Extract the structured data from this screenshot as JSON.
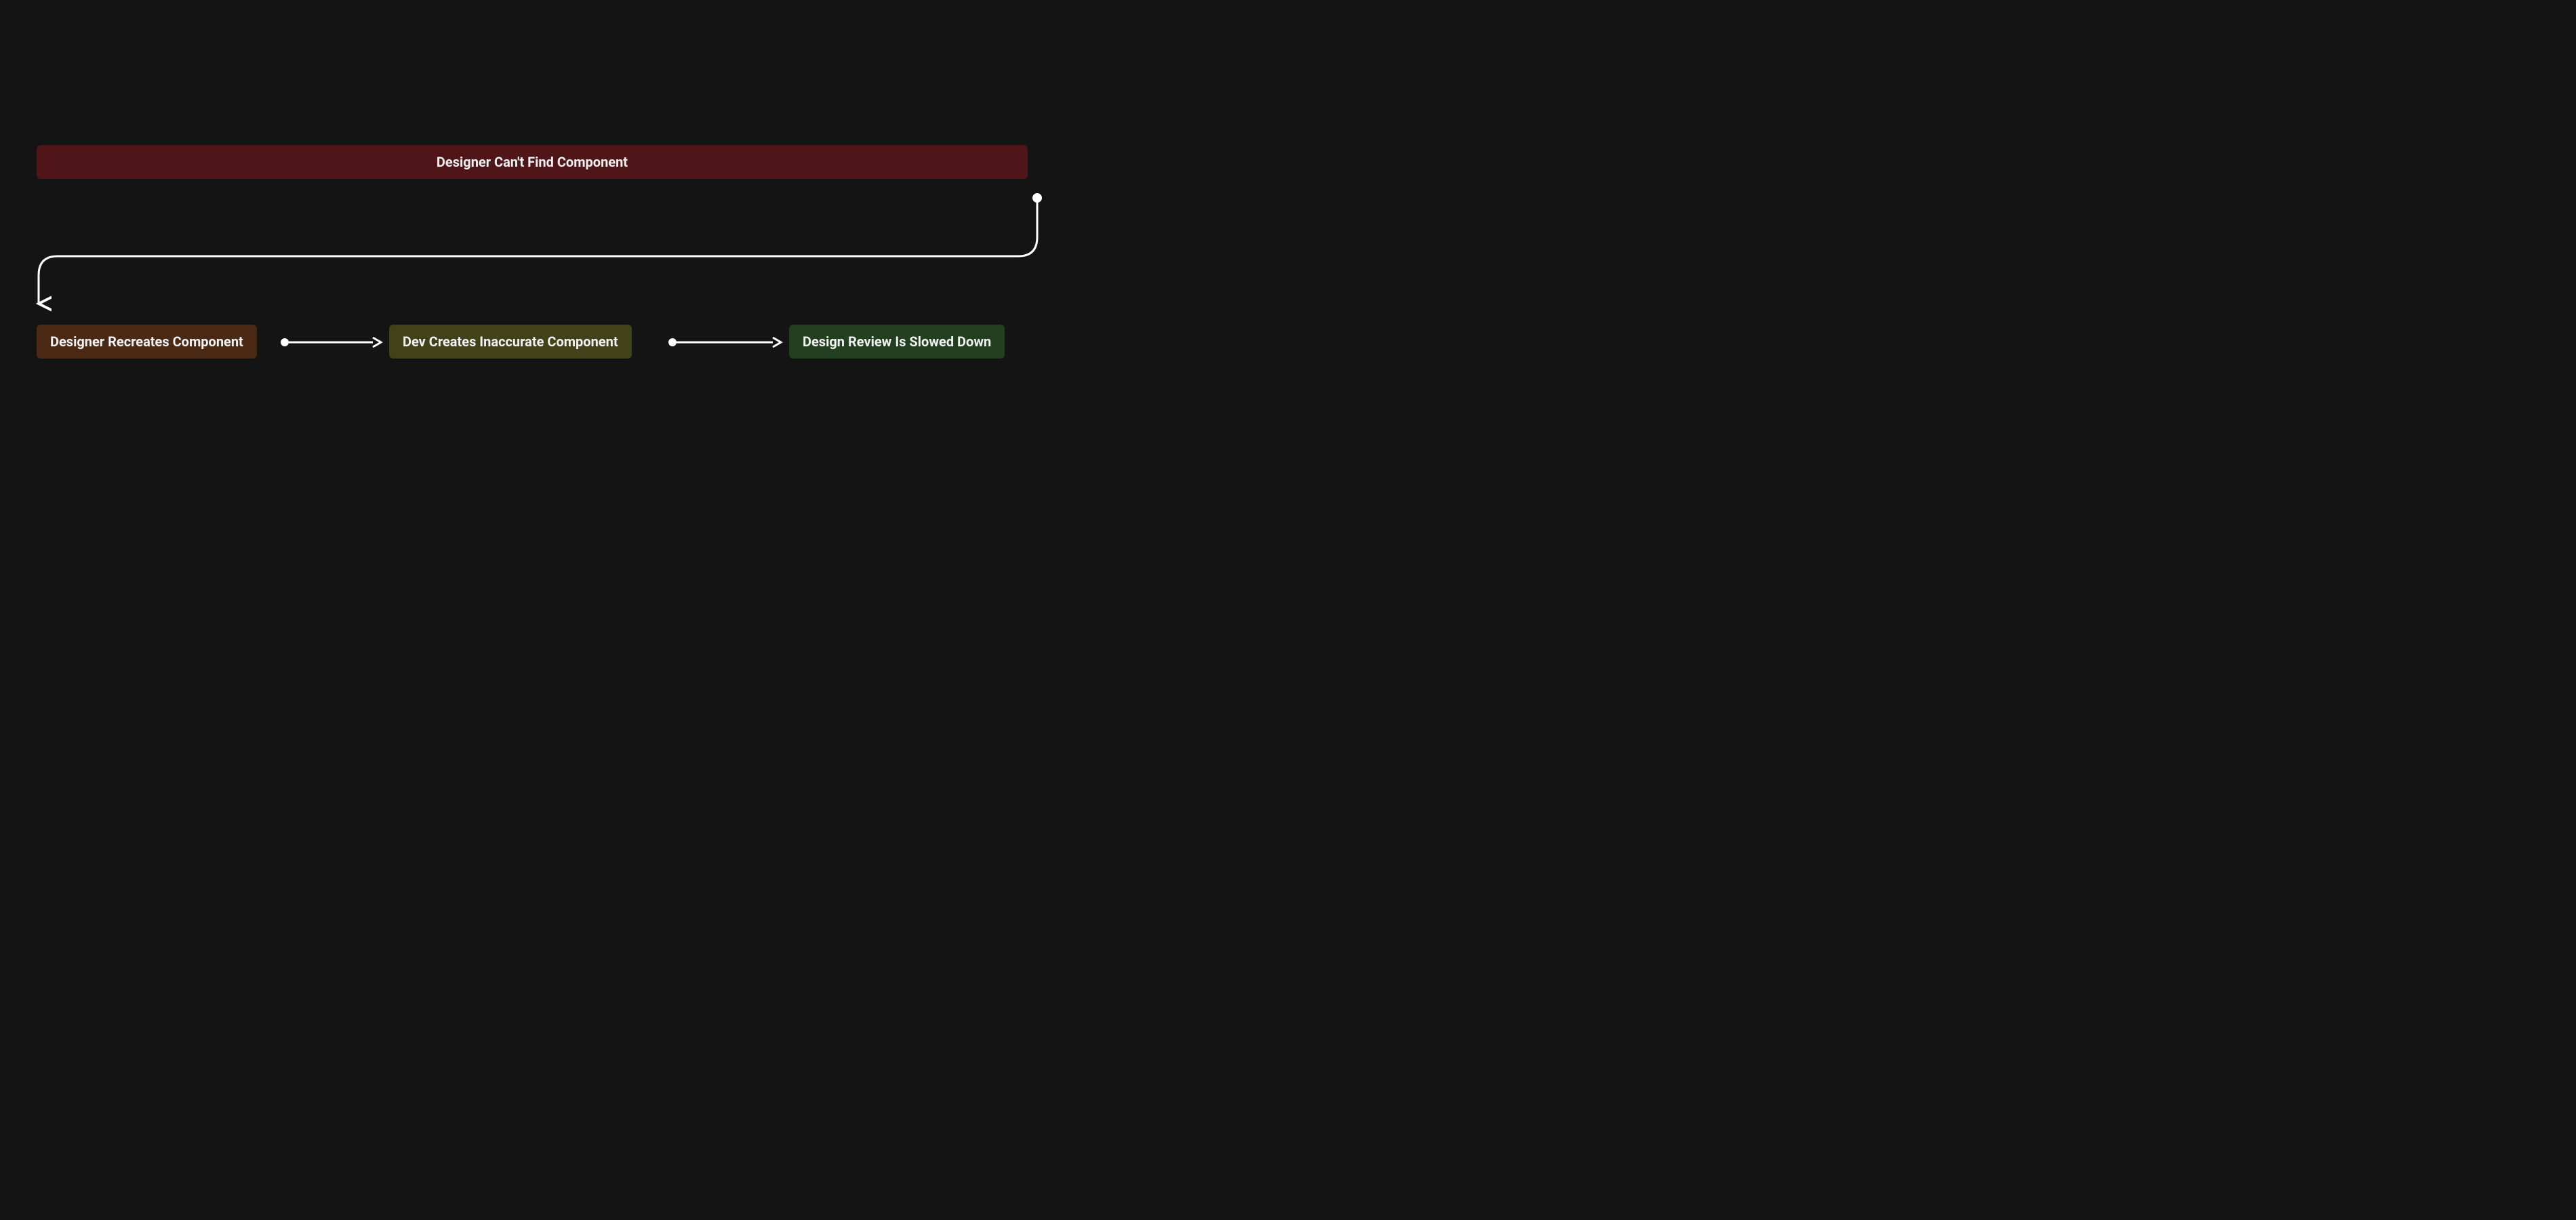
{
  "colors": {
    "background": "#141414",
    "text": "#f2f2f2",
    "node_top": "#501518",
    "node_a": "#4a2a15",
    "node_b": "#41411a",
    "node_c": "#22401f",
    "connector": "#ffffff"
  },
  "nodes": {
    "top": {
      "label": "Designer Can't Find Component"
    },
    "a": {
      "label": "Designer Recreates Component"
    },
    "b": {
      "label": "Dev Creates Inaccurate Component"
    },
    "c": {
      "label": "Design Review Is Slowed Down"
    }
  }
}
